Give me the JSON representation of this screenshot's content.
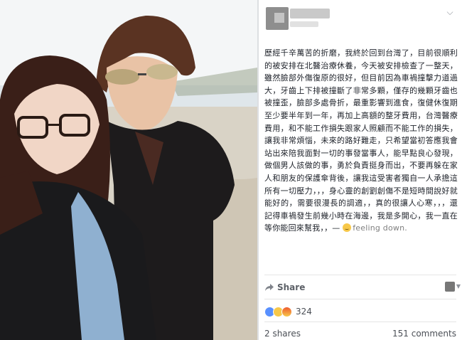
{
  "post": {
    "text": "歷經千辛萬苦的折磨，我終於回到台灣了，目前很順利的被安排在北醫治療休養，今天被安排檢查了一整天，雖然臉部外傷復原的很好，但目前因為車禍撞擊力道過大，牙齒上下排被撞斷了非常多顆，僅存的幾顆牙齒也被撞歪，臉部多處骨折，最重影響到進食，復健休復期至少要半年到一年，再加上高額的整牙費用，台灣醫療費用，和不能工作損失跟家人照顧而不能工作的損失，讓我非常煩惱，未來的路好難走，只希望當初答應我會站出來陪我面對一切的事發當事人，能早點良心發現，做個男人該做的事，勇於負責挺身而出，不要再躲在家人和朋友的保護傘背後，讓我這受害者獨自一人承擔這所有一切壓力，，，身心靈的創劉創傷不是短時間說好就能好的，需要很漫長的調適，，真的很讓人心寒，，，還記得車禍發生前幾小時在海邊，我是多開心，我一直在等你能回來幫我，，—",
    "feeling": "feeling down."
  },
  "actions": {
    "share_label": "Share"
  },
  "stats": {
    "reaction_count": "324",
    "shares": "2 shares",
    "comments": "151 comments"
  },
  "colors": {
    "text": "#1d2129",
    "muted": "#90949c",
    "like_blue": "#5890ff"
  }
}
